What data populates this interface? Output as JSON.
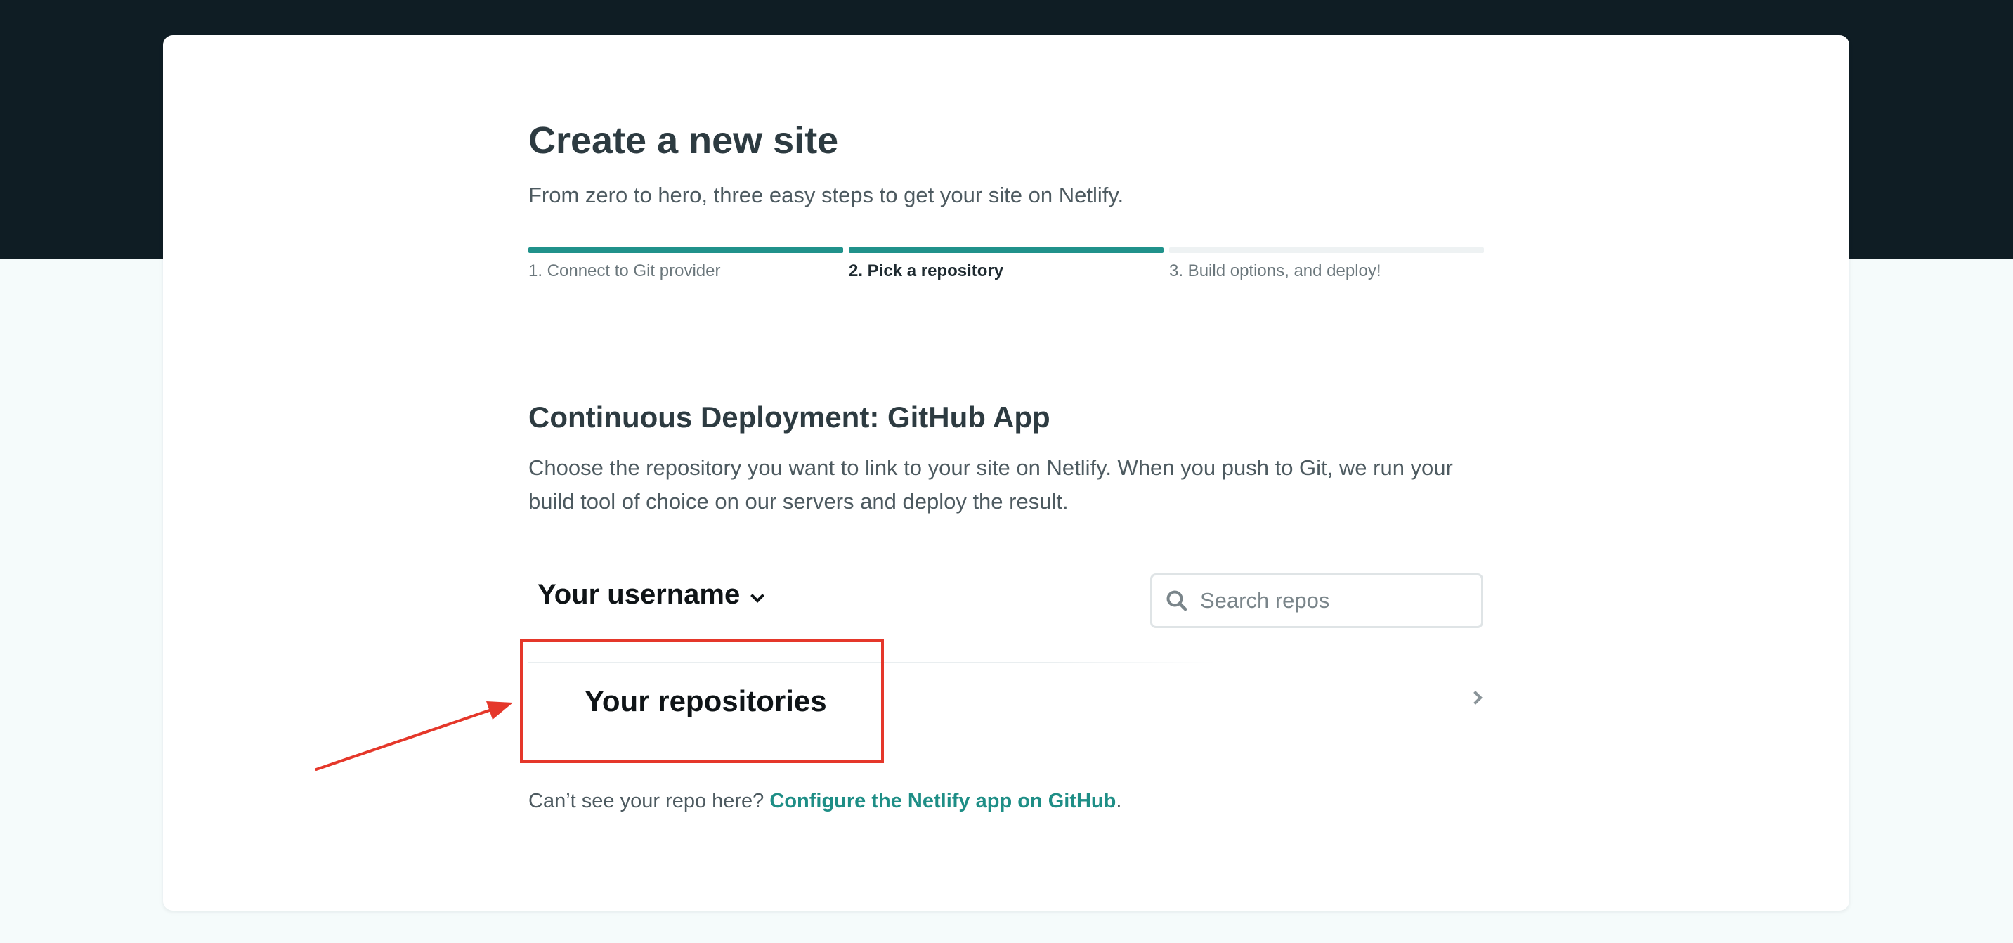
{
  "colors": {
    "header_band": "#0f1d24",
    "page_background": "#f5fbfb",
    "accent": "#20928b",
    "link": "#1e8e86",
    "annotation": "#e5372a"
  },
  "header": {
    "title": "Create a new site",
    "subtitle": "From zero to hero, three easy steps to get your site on Netlify."
  },
  "steps": [
    {
      "label": "1. Connect to Git provider",
      "state": "complete"
    },
    {
      "label": "2. Pick a repository",
      "state": "current"
    },
    {
      "label": "3. Build options, and deploy!",
      "state": "upcoming"
    }
  ],
  "section": {
    "title": "Continuous Deployment: GitHub App",
    "description": "Choose the repository you want to link to your site on Netlify. When you push to Git, we run your build tool of choice on our servers and deploy the result."
  },
  "account_selector": {
    "label": "Your username",
    "icon": "chevron-down-icon"
  },
  "search": {
    "placeholder": "Search repos",
    "value": "",
    "icon": "search-icon"
  },
  "repositories": [
    {
      "label": "Your repositories",
      "icon": "chevron-right-icon"
    }
  ],
  "footer": {
    "prefix": "Can’t see your repo here? ",
    "link_text": "Configure the Netlify app on GitHub",
    "suffix": "."
  }
}
